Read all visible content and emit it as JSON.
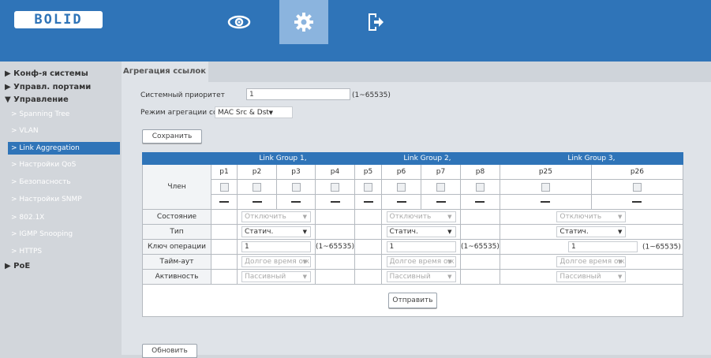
{
  "brand": "BOLID",
  "colors": {
    "accent": "#2f74b8",
    "active_nav": "#8bb4de",
    "background": "#d2d6db"
  },
  "top_nav": [
    {
      "icon": "eye-icon",
      "active": false
    },
    {
      "icon": "gear-icon",
      "active": true
    },
    {
      "icon": "logout-icon",
      "active": false
    }
  ],
  "sidebar": {
    "sections": [
      {
        "label": "▶ Конф-я системы"
      },
      {
        "label": "▶ Управл. портами"
      },
      {
        "label": "▼ Управление"
      }
    ],
    "items": [
      {
        "label": "> Spanning Tree"
      },
      {
        "label": "> VLAN"
      },
      {
        "label": "> Link Aggregation",
        "active": true
      },
      {
        "label": "> Настройки QoS"
      },
      {
        "label": "> Безопасность"
      },
      {
        "label": "> Настройки SNMP"
      },
      {
        "label": "> 802.1X"
      },
      {
        "label": "> IGMP Snooping"
      },
      {
        "label": "> HTTPS"
      }
    ],
    "poe": "▶ PoE"
  },
  "page": {
    "tab": "Агрегация ссылок",
    "priority_label": "Системный приоритет",
    "priority_value": "1",
    "priority_range": "(1~65535)",
    "mode_label": "Режим агрегации ссылок",
    "mode_value": "MAC Src & Dst",
    "save_button": "Сохранить",
    "submit_button": "Отправить",
    "refresh_button": "Обновить"
  },
  "table": {
    "groups": [
      "Link Group 1,",
      "Link Group 2,",
      "Link Group 3,"
    ],
    "ports": [
      "p1",
      "p2",
      "p3",
      "p4",
      "p5",
      "p6",
      "p7",
      "p8",
      "p25",
      "p26"
    ],
    "rows": {
      "member": "Член",
      "state": "Состояние",
      "type": "Тип",
      "key": "Ключ операции",
      "timeout": "Тайм-аут",
      "activity": "Активность"
    },
    "state_value": "Отключить",
    "type_value": "Статич.",
    "key_value": "1",
    "key_range": "(1~65535)",
    "timeout_value": "Долгое время ож",
    "activity_value": "Пассивный"
  }
}
